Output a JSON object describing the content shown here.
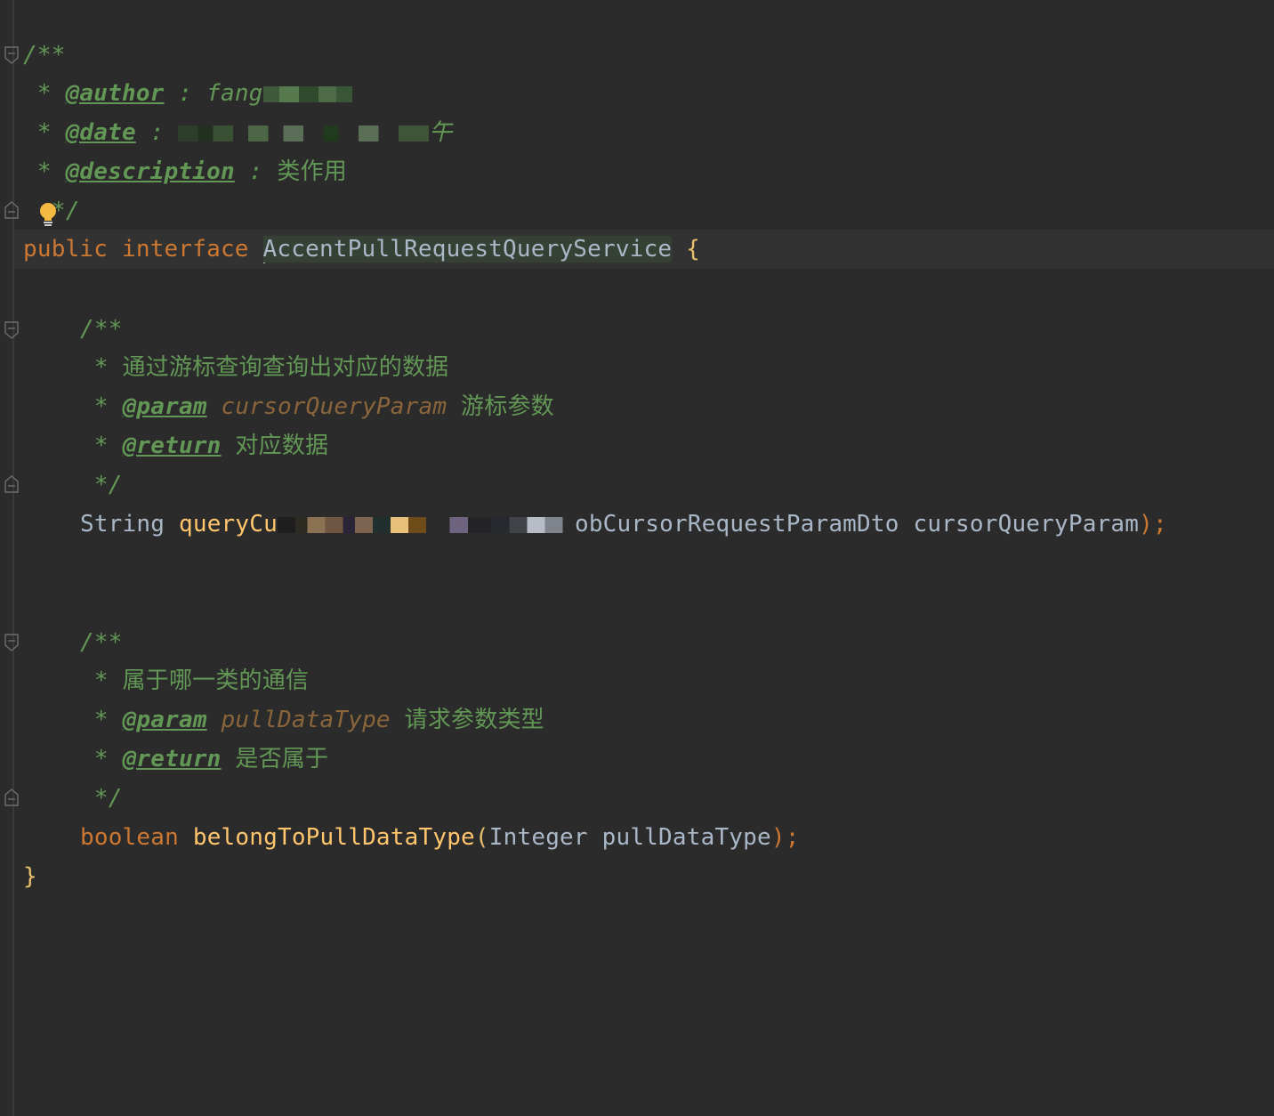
{
  "editor": {
    "class_doc": {
      "open": "/**",
      "author_prefix": " * ",
      "author_tag": "@author",
      "author_sep": " : ",
      "author_value": "fang",
      "date_prefix": " * ",
      "date_tag": "@date",
      "date_sep": " : ",
      "date_suffix": "午",
      "desc_prefix": " * ",
      "desc_tag": "@description",
      "desc_sep": " : ",
      "desc_value": "类作用",
      "close": "*/"
    },
    "interface_decl": {
      "kw_public": "public",
      "kw_interface": "interface",
      "name": "AccentPullRequestQueryService",
      "open_brace": "{"
    },
    "method1_doc": {
      "open": "/**",
      "line1": " * 通过游标查询查询出对应的数据",
      "param_prefix": " * ",
      "param_tag": "@param",
      "param_name": "cursorQueryParam",
      "param_desc": " 游标参数",
      "return_prefix": " * ",
      "return_tag": "@return",
      "return_desc": " 对应数据",
      "close": " */"
    },
    "method1_sig": {
      "return_type": "String",
      "name_visible": "queryCu",
      "param_type_visible": "obCursorRequestParamDto",
      "param_name": "cursorQueryParam",
      "close": ");"
    },
    "method2_doc": {
      "open": "/**",
      "line1": " * 属于哪一类的通信",
      "param_prefix": " * ",
      "param_tag": "@param",
      "param_name": "pullDataType",
      "param_desc": " 请求参数类型",
      "return_prefix": " * ",
      "return_tag": "@return",
      "return_desc": " 是否属于",
      "close": " */"
    },
    "method2_sig": {
      "return_type": "boolean",
      "name": "belongToPullDataType",
      "open_paren": "(",
      "param_type": "Integer",
      "param_name": "pullDataType",
      "close": ");"
    },
    "close_brace": "}"
  },
  "icons": {
    "fold": "fold-marker-icon",
    "intention": "lightbulb-icon"
  },
  "colors": {
    "background": "#2b2b2b",
    "doc_comment": "#629755",
    "keyword": "#cc7832",
    "method": "#ffc66d",
    "text": "#a9b7c6",
    "param": "#8a653b"
  }
}
